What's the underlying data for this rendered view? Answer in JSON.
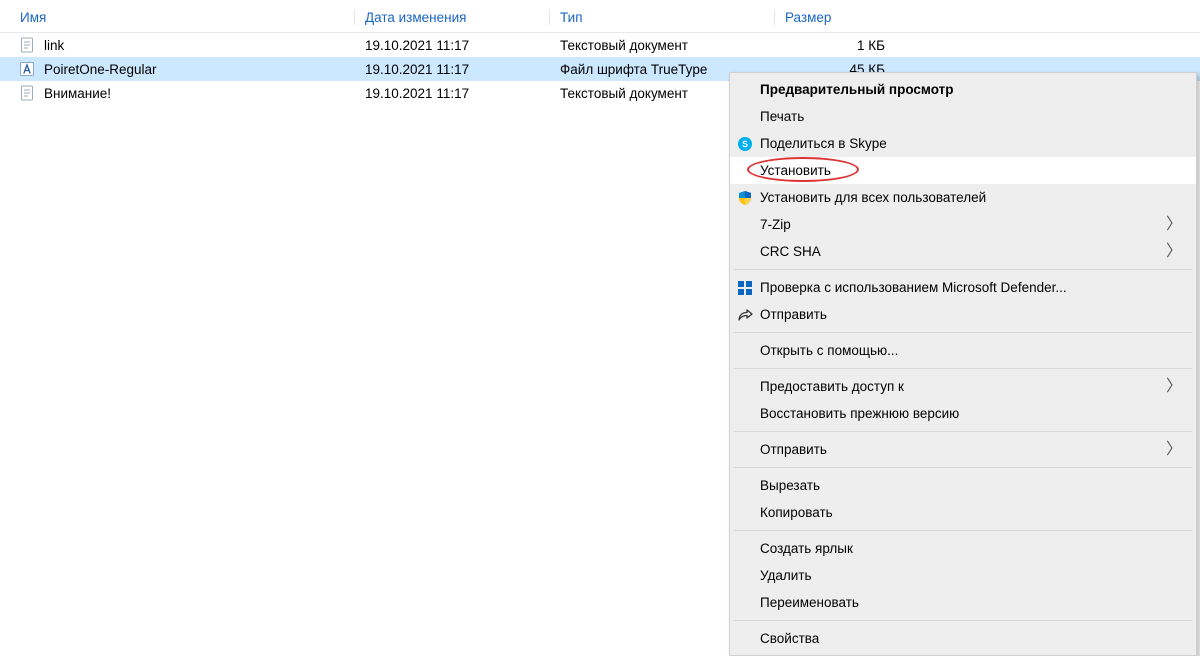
{
  "columns": {
    "name": "Имя",
    "date": "Дата изменения",
    "type": "Тип",
    "size": "Размер"
  },
  "rows": [
    {
      "name": "link",
      "date": "19.10.2021 11:17",
      "type": "Текстовый документ",
      "size": "1 КБ",
      "filetype": "text",
      "selected": false
    },
    {
      "name": "PoiretOne-Regular",
      "date": "19.10.2021 11:17",
      "type": "Файл шрифта TrueType",
      "size": "45 КБ",
      "filetype": "font",
      "selected": true
    },
    {
      "name": "Внимание!",
      "date": "19.10.2021 11:17",
      "type": "Текстовый документ",
      "size": "",
      "filetype": "text",
      "selected": false
    }
  ],
  "context_menu": [
    {
      "label": "Предварительный просмотр",
      "bold": true
    },
    {
      "label": "Печать"
    },
    {
      "label": "Поделиться в Skype",
      "icon": "skype"
    },
    {
      "label": "Установить",
      "highlight": true
    },
    {
      "label": "Установить для всех пользователей",
      "icon": "shield"
    },
    {
      "label": "7-Zip",
      "submenu": true
    },
    {
      "label": "CRC SHA",
      "submenu": true
    },
    {
      "sep": true
    },
    {
      "label": "Проверка с использованием Microsoft Defender...",
      "icon": "defender"
    },
    {
      "label": "Отправить",
      "icon": "share"
    },
    {
      "sep": true
    },
    {
      "label": "Открыть с помощью..."
    },
    {
      "sep": true
    },
    {
      "label": "Предоставить доступ к",
      "submenu": true
    },
    {
      "label": "Восстановить прежнюю версию"
    },
    {
      "sep": true
    },
    {
      "label": "Отправить",
      "submenu": true
    },
    {
      "sep": true
    },
    {
      "label": "Вырезать"
    },
    {
      "label": "Копировать"
    },
    {
      "sep": true
    },
    {
      "label": "Создать ярлык"
    },
    {
      "label": "Удалить"
    },
    {
      "label": "Переименовать"
    },
    {
      "sep": true
    },
    {
      "label": "Свойства"
    }
  ]
}
